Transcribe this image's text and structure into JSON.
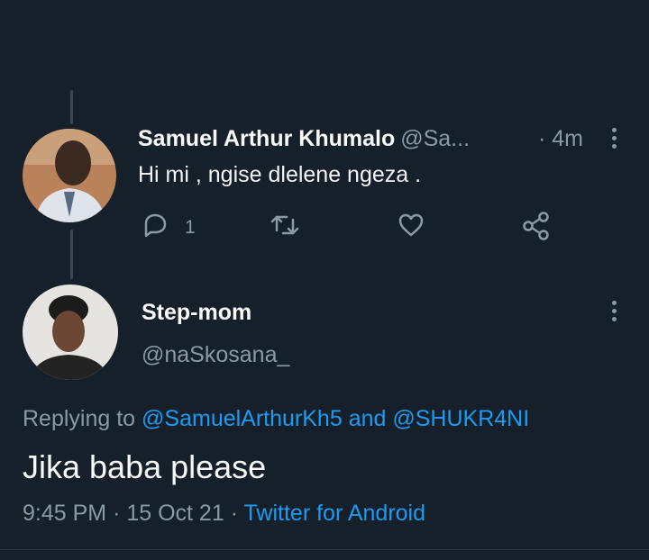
{
  "parent_tweet": {
    "display_name": "Samuel Arthur Khumalo",
    "handle": "@Sa...",
    "time": "· 4m",
    "text": "Hi mi , ngise dlelene ngeza .",
    "reply_count": "1",
    "avatar_icon": "avatar-photo"
  },
  "main_tweet": {
    "display_name": "Step-mom",
    "handle": "@naSkosana_",
    "replying_prefix": "Replying to",
    "replying_mention_1": "@SamuelArthurKh5",
    "replying_and": "and",
    "replying_mention_2": "@SHUKR4NI",
    "text": "Jika baba please",
    "time": "9:45 PM",
    "separator": "·",
    "date": "15 Oct 21",
    "source": "Twitter for Android",
    "avatar_icon": "avatar-photo"
  },
  "icons": {
    "reply": "reply-icon",
    "retweet": "retweet-icon",
    "like": "like-icon",
    "share": "share-icon",
    "more": "more-vertical-icon"
  },
  "colors": {
    "background": "#15202b",
    "accent": "#1d9bf0",
    "secondary_text": "#8b98a5",
    "primary_text": "#f7f9f9"
  }
}
